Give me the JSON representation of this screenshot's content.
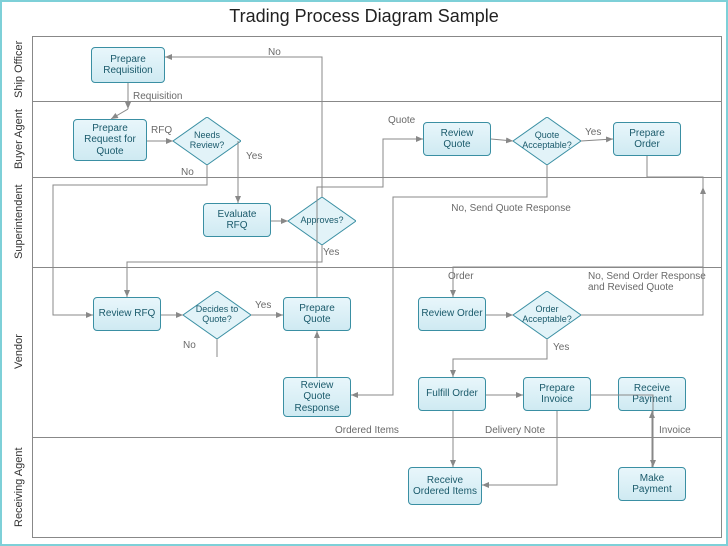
{
  "title": "Trading Process Diagram Sample",
  "lanes": [
    "Ship Officer",
    "Buyer Agent",
    "Superintendent",
    "Vendor",
    "Receiving Agent"
  ],
  "boxes": {
    "b1": "Prepare Requisition",
    "b2": "Prepare Request for Quote",
    "b3": "Needs Review?",
    "b4": "Evaluate RFQ",
    "b5": "Approves?",
    "b6": "Review RFQ",
    "b7": "Decides to Quote?",
    "b8": "Prepare Quote",
    "b9": "Review Quote",
    "b10": "Quote Acceptable?",
    "b11": "Prepare Order",
    "b12": "Review Order",
    "b13": "Order Acceptable?",
    "b14": "Fulfill Order",
    "b15": "Review Quote Response",
    "b16": "Prepare Invoice",
    "b17": "Receive Ordered Items",
    "b18": "Receive Payment",
    "b19": "Make Payment"
  },
  "edges": {
    "e_no1": "No",
    "e_req": "Requisition",
    "e_rfq": "RFQ",
    "e_yes1": "Yes",
    "e_no2": "No",
    "e_yes2": "Yes",
    "e_no3": "No",
    "e_yes3": "Yes",
    "e_quote": "Quote",
    "e_yes4": "Yes",
    "e_noSend": "No, Send Quote Response",
    "e_order": "Order",
    "e_noSendOrder": "No, Send Order Response and Revised Quote",
    "e_yes5": "Yes",
    "e_ordItems": "Ordered Items",
    "e_delNote": "Delivery Note",
    "e_invoice": "Invoice"
  }
}
